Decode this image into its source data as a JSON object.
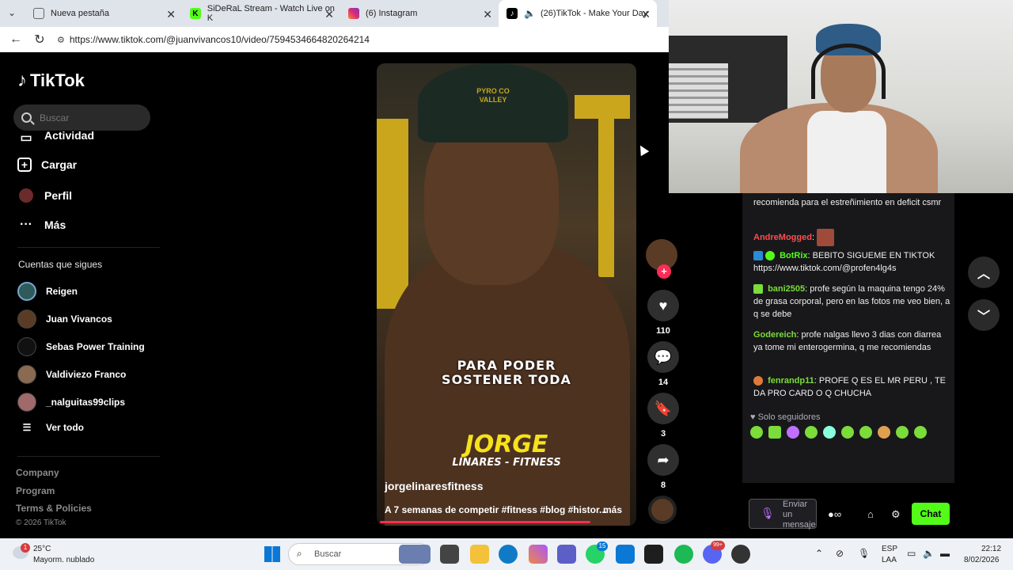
{
  "tabs": [
    {
      "title": "Nueva pestaña",
      "icon": "new-tab-icon"
    },
    {
      "title": "SiDeRaL Stream - Watch Live on K",
      "icon": "kick-icon"
    },
    {
      "title": "(6) Instagram",
      "icon": "instagram-icon"
    },
    {
      "title": "(26)TikTok - Make Your Day",
      "icon": "tiktok-icon"
    }
  ],
  "address": {
    "url": "https://www.tiktok.com/@juanvivancos10/video/7594534664820264214"
  },
  "sidebar": {
    "logo": "TikTok",
    "search_placeholder": "Buscar",
    "menu": [
      {
        "label": "Actividad",
        "icon": "activity-icon"
      },
      {
        "label": "Cargar",
        "icon": "upload-icon"
      },
      {
        "label": "Perfil",
        "icon": "profile-icon"
      },
      {
        "label": "Más",
        "icon": "more-icon"
      }
    ],
    "following_title": "Cuentas que sigues",
    "accounts": [
      "Reigen",
      "Juan Vivancos",
      "Sebas Power Training",
      "Valdiviezo Franco",
      "_nalguitas99clips"
    ],
    "view_all": "Ver todo",
    "footer": [
      "Company",
      "Program",
      "Terms & Policies"
    ],
    "copyright": "© 2026 TikTok"
  },
  "video": {
    "overlay_line1": "PARA PODER",
    "overlay_line2": "SOSTENER TODA",
    "overlay_name": "JORGE",
    "overlay_sub": "LINARES - FITNESS",
    "cap_text": "PYRO CO VALLEY",
    "author": "jorgelinaresfitness",
    "description": "A 7 semanas de competir #fitness #blog #histor...",
    "more": "más",
    "progress": 0.83
  },
  "actions": {
    "likes": "110",
    "comments": "14",
    "saves": "3",
    "shares": "8"
  },
  "chat": {
    "messages": [
      {
        "user": "",
        "text": "recomienda para el estreñimiento en deficit csmr",
        "color": "#efeff1"
      },
      {
        "user": "AndreMogged",
        "text": "",
        "color": "#ff4d4d"
      },
      {
        "user": "BotRix",
        "text": "BEBITO SIGUEME EN TIKTOK https://www.tiktok.com/@profen4lg4s",
        "color": "#53fc18"
      },
      {
        "user": "bani2505",
        "text": "profe según la maquina tengo 24% de grasa corporal, pero en las fotos me veo bien, a q se debe",
        "color": "#7bdc3a"
      },
      {
        "user": "Godereich",
        "text": "profe nalgas llevo 3 dias con diarrea ya tome mi enterogermina, q me recomiendas",
        "color": "#7bdc3a"
      },
      {
        "user": "fenrandp11",
        "text": "PROFE Q ES EL MR PERU , TE DA PRO CARD O Q CHUCHA",
        "color": "#7bdc3a"
      }
    ],
    "followers_only": "Solo seguidores",
    "input_placeholder": "Enviar un mensaje",
    "send_label": "Chat"
  },
  "taskbar": {
    "weather_temp": "25°C",
    "weather_desc": "Mayorm. nublado",
    "weather_badge": "1",
    "search_label": "Buscar",
    "lang1": "ESP",
    "lang2": "LAA",
    "time": "22:12",
    "date": "8/02/2026",
    "whatsapp_badge": "15",
    "discord_badge": "99+"
  }
}
